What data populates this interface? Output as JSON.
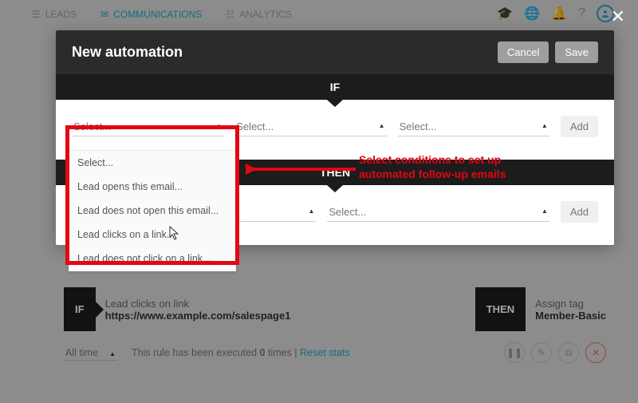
{
  "nav": {
    "leads": "LEADS",
    "communications": "COMMUNICATIONS",
    "analytics": "ANALYTICS"
  },
  "modal": {
    "title": "New automation",
    "cancel": "Cancel",
    "save": "Save",
    "if_label": "IF",
    "then_label": "THEN",
    "select_placeholder": "Select...",
    "add": "Add"
  },
  "dropdown": {
    "options": [
      "Select...",
      "Lead opens this email...",
      "Lead does not open this email...",
      "Lead clicks on a link...",
      "Lead does not click on a link..."
    ]
  },
  "annotation": {
    "text_line1": "Select conditions to set up",
    "text_line2": "automated follow-up emails"
  },
  "rule": {
    "if_caption": "Lead clicks on link",
    "if_value": "https://www.example.com/salespage1",
    "then_caption": "Assign tag",
    "then_value": "Member-Basic",
    "alltime": "All time",
    "exec_prefix": "This rule has been executed ",
    "exec_count": "0",
    "exec_suffix": " times",
    "reset": "Reset stats"
  }
}
